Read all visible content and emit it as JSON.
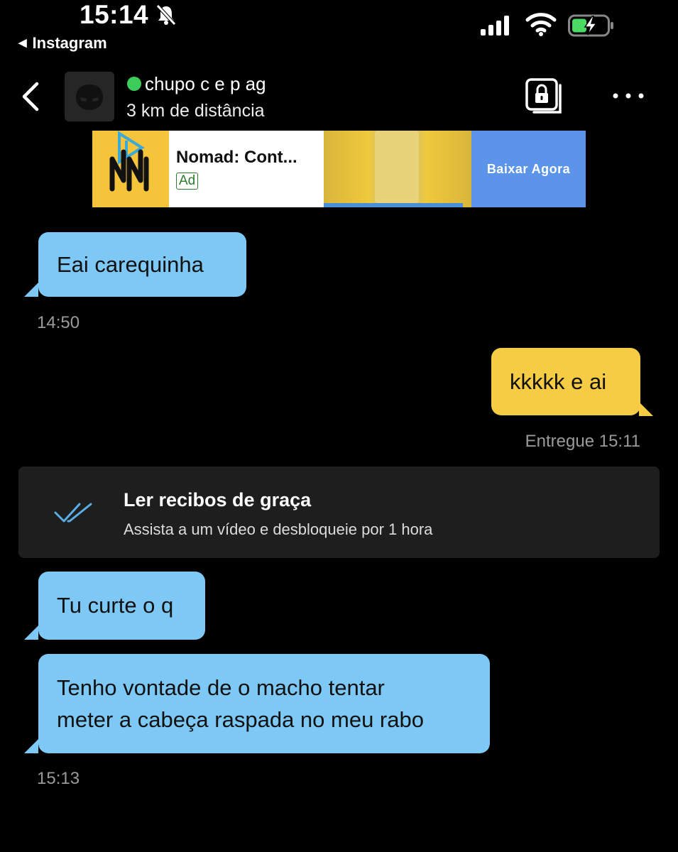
{
  "status_bar": {
    "time": "15:14",
    "back_app": "Instagram",
    "icons": [
      "bell-slash-icon",
      "cellular-signal-icon",
      "wifi-icon",
      "battery-charging-icon"
    ]
  },
  "header": {
    "name": "chupo c e p ag",
    "distance": "3 km de distância",
    "online": true,
    "icons": [
      "chevron-left-icon",
      "private-album-icon",
      "more-icon"
    ]
  },
  "ad": {
    "title": "Nomad: Cont...",
    "badge": "Ad",
    "cta": "Baixar Agora"
  },
  "messages": [
    {
      "direction": "received",
      "text": "Eai carequinha",
      "timestamp": "14:50"
    },
    {
      "direction": "sent",
      "text": "kkkkk e ai",
      "timestamp": "Entregue 15:11"
    },
    {
      "direction": "received",
      "text": "Tu curte o q"
    },
    {
      "direction": "received",
      "lines": [
        "Tenho vontade de o macho tentar",
        "meter a cabeça raspada no meu rabo"
      ],
      "timestamp": "15:13"
    }
  ],
  "read_receipts_card": {
    "title": "Ler recibos de graça",
    "subtitle": "Assista a um vídeo e desbloqueie por 1 hora"
  },
  "colors": {
    "background": "#000000",
    "received_bubble": "#7ec8f5",
    "sent_bubble": "#f6cc44",
    "card_bg": "#1e1e1e",
    "online_dot": "#3ccc5a",
    "ad_cta": "#5b94e8"
  }
}
